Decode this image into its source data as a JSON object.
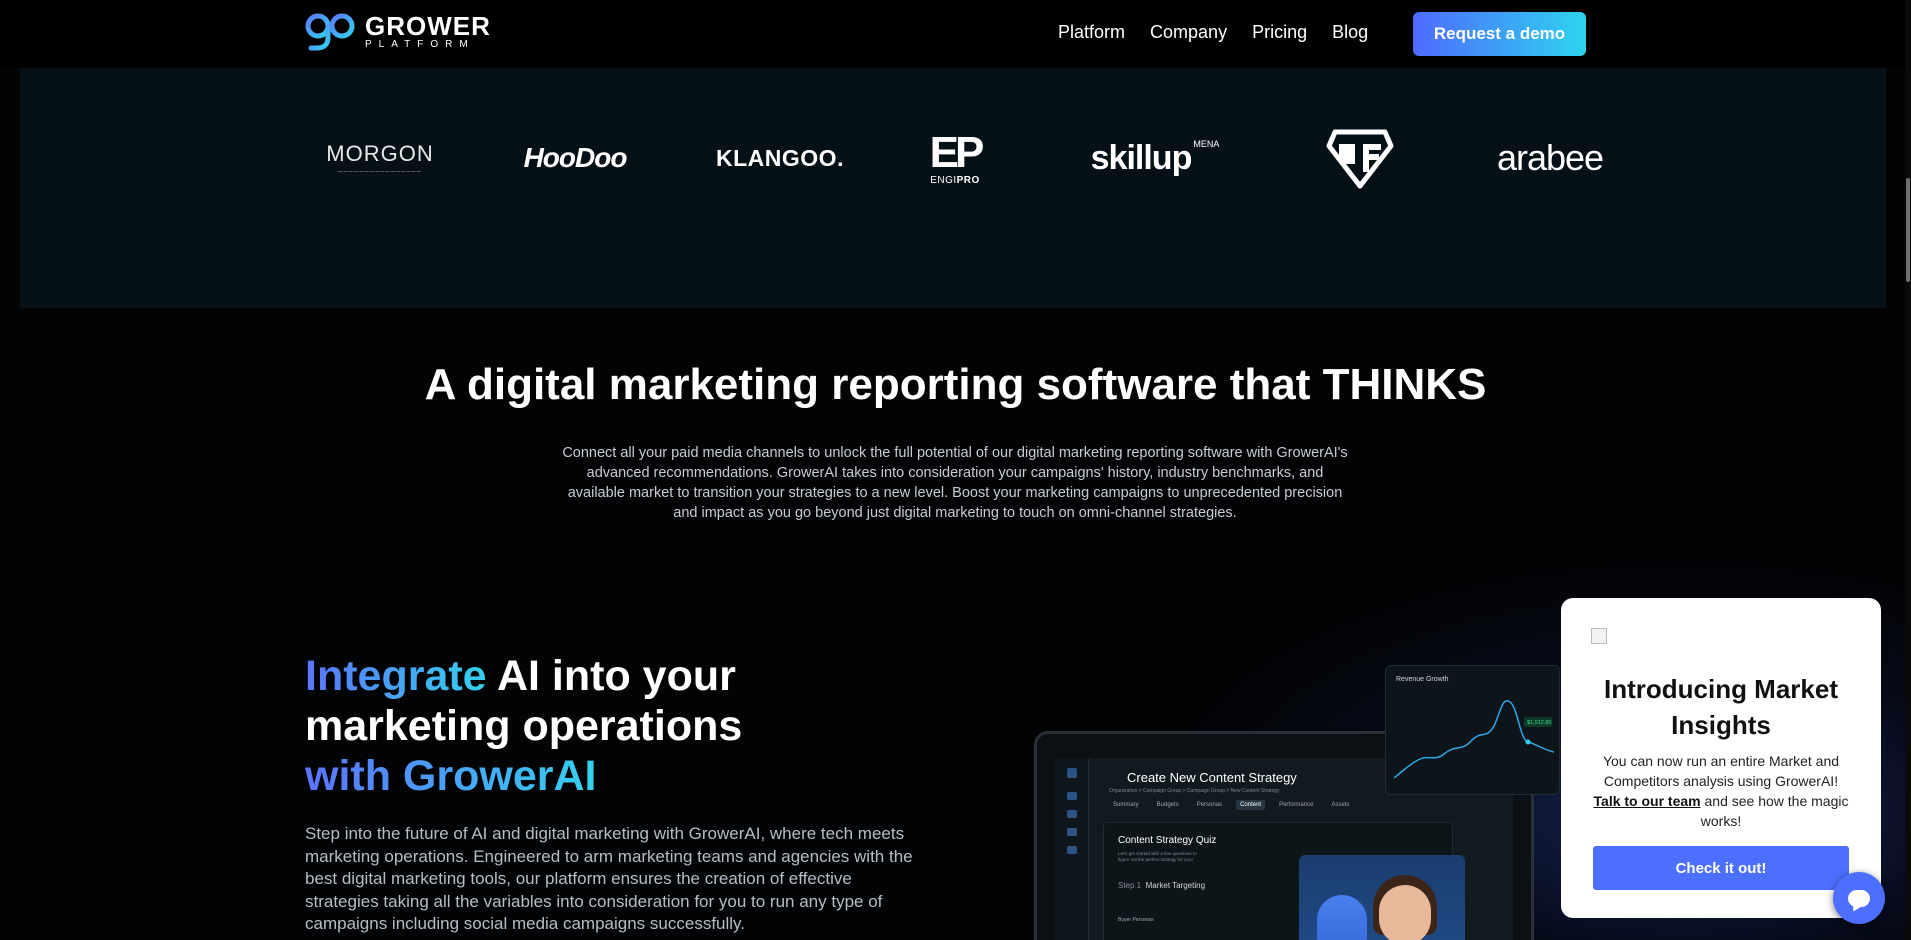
{
  "header": {
    "logo_line1": "GROWER",
    "logo_line2": "PLATFORM",
    "nav": [
      "Platform",
      "Company",
      "Pricing",
      "Blog"
    ],
    "cta_label": "Request a demo"
  },
  "client_logos": {
    "morgon": "MORGON",
    "hoodoo": "HooDoo",
    "klangoo": "KLANGOO.",
    "engipro_mark": "EP",
    "engipro_text_a": "ENGI",
    "engipro_text_b": "PRO",
    "skillup": "skillup",
    "skillup_sup": "MENA",
    "arabee": "arabee"
  },
  "hero": {
    "title": "A digital marketing reporting software that THINKS",
    "lead": "Connect all your  paid media channels to unlock the full potential of our digital marketing reporting software with GrowerAI's advanced recommendations. GrowerAI takes into consideration your campaigns' history, industry benchmarks, and available market to transition your strategies to a new level. Boost your marketing campaigns to unprecedented precision and impact as you go beyond just digital marketing to touch on omni-channel strategies."
  },
  "feature": {
    "title_a": "Integrate",
    "title_b": " AI into your marketing operations",
    "title_c": "with GrowerAI",
    "body": "Step into the future of AI and digital marketing with GrowerAI, where tech meets marketing operations. Engineered to arm marketing teams and agencies with the best digital marketing tools, our platform ensures the creation of effective strategies taking all the variables into consideration for you to run any type of campaigns including social media campaigns  successfully."
  },
  "mockup": {
    "title": "Create New Content Strategy",
    "breadcrumb": "Organization > Campaign Group > Campaign Group > New Content Strategy",
    "tabs": [
      "Summary",
      "Budgets",
      "Personas",
      "Content",
      "Performance",
      "Assets"
    ],
    "active_tab": "Content",
    "quiz_title": "Content Strategy Quiz",
    "quiz_sub": "Let's get started with a few questions to figure out the perfect strategy for you!",
    "step_label": "Step 1",
    "step_title": "Market Targeting",
    "buyer_personas": "Buyer Personas",
    "revenue_title": "Revenue Growth",
    "revenue_value": "$1,912.80"
  },
  "popup": {
    "title": "Introducing Market Insights",
    "text_before": "You can now run an entire Market and Competitors analysis using GrowerAI!",
    "link": "Talk to our team",
    "text_after": " and see how the magic works!",
    "button": "Check it out!"
  },
  "colors": {
    "accent_start": "#4e6bff",
    "accent_end": "#2ed3ee",
    "popup_button": "#4d6fff",
    "background": "#020305",
    "logo_strip": "#061117"
  },
  "icons": [
    "grower-logo-icon",
    "gf-logo-icon",
    "broken-image-icon",
    "chat-icon"
  ]
}
